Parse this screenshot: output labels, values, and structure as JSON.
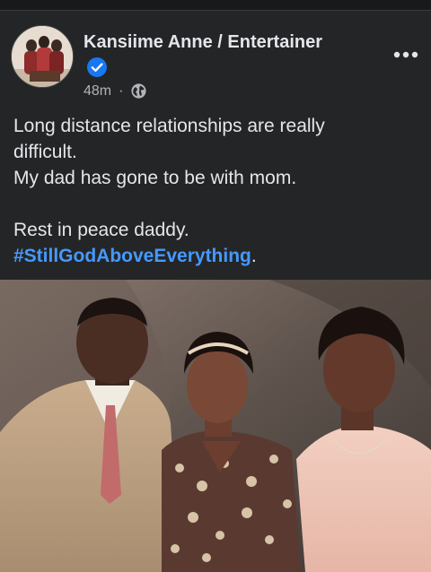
{
  "post": {
    "author": "Kansiime Anne / Entertainer",
    "timestamp": "48m",
    "separator": "·",
    "visibility_icon": "globe-icon",
    "verified_icon": "verified-badge-icon",
    "more_icon": "more-options-icon",
    "lines": [
      "Long distance relationships are really",
      "difficult.",
      "My dad has gone to be with mom.",
      "",
      "Rest in peace daddy."
    ],
    "hashtag": "#StillGodAboveEverything",
    "hashtag_suffix": ".",
    "colors": {
      "background": "#242526",
      "text": "#e4e6eb",
      "secondary_text": "#b0b3b8",
      "link": "#4599ff",
      "verified": "#1877f2"
    }
  }
}
